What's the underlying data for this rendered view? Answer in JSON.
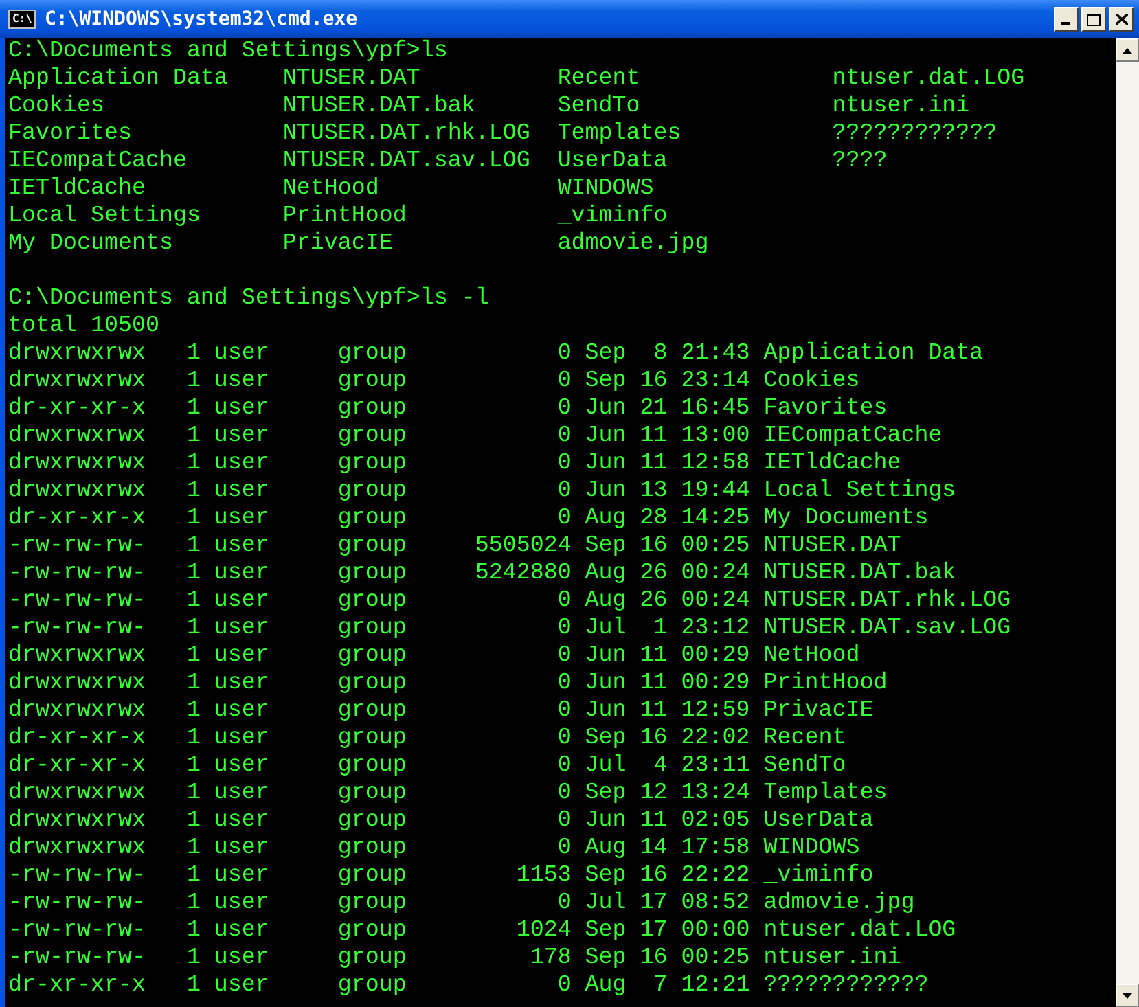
{
  "window": {
    "icon_label": "C:\\",
    "title": "C:\\WINDOWS\\system32\\cmd.exe"
  },
  "console": {
    "blocks": [
      [
        "C:\\Documents and Settings\\ypf>ls",
        "Application Data    NTUSER.DAT          Recent              ntuser.dat.LOG",
        "Cookies             NTUSER.DAT.bak      SendTo              ntuser.ini",
        "Favorites           NTUSER.DAT.rhk.LOG  Templates           ????????????",
        "IECompatCache       NTUSER.DAT.sav.LOG  UserData            ????",
        "IETldCache          NetHood             WINDOWS",
        "Local Settings      PrintHood           _viminfo",
        "My Documents        PrivacIE            admovie.jpg"
      ],
      [
        "C:\\Documents and Settings\\ypf>ls -l",
        "total 10500",
        "drwxrwxrwx   1 user     group           0 Sep  8 21:43 Application Data",
        "drwxrwxrwx   1 user     group           0 Sep 16 23:14 Cookies",
        "dr-xr-xr-x   1 user     group           0 Jun 21 16:45 Favorites",
        "drwxrwxrwx   1 user     group           0 Jun 11 13:00 IECompatCache",
        "drwxrwxrwx   1 user     group           0 Jun 11 12:58 IETldCache",
        "drwxrwxrwx   1 user     group           0 Jun 13 19:44 Local Settings",
        "dr-xr-xr-x   1 user     group           0 Aug 28 14:25 My Documents",
        "-rw-rw-rw-   1 user     group     5505024 Sep 16 00:25 NTUSER.DAT",
        "-rw-rw-rw-   1 user     group     5242880 Aug 26 00:24 NTUSER.DAT.bak",
        "-rw-rw-rw-   1 user     group           0 Aug 26 00:24 NTUSER.DAT.rhk.LOG",
        "-rw-rw-rw-   1 user     group           0 Jul  1 23:12 NTUSER.DAT.sav.LOG",
        "drwxrwxrwx   1 user     group           0 Jun 11 00:29 NetHood",
        "drwxrwxrwx   1 user     group           0 Jun 11 00:29 PrintHood",
        "drwxrwxrwx   1 user     group           0 Jun 11 12:59 PrivacIE",
        "dr-xr-xr-x   1 user     group           0 Sep 16 22:02 Recent",
        "dr-xr-xr-x   1 user     group           0 Jul  4 23:11 SendTo",
        "drwxrwxrwx   1 user     group           0 Sep 12 13:24 Templates",
        "drwxrwxrwx   1 user     group           0 Jun 11 02:05 UserData",
        "drwxrwxrwx   1 user     group           0 Aug 14 17:58 WINDOWS",
        "-rw-rw-rw-   1 user     group        1153 Sep 16 22:22 _viminfo",
        "-rw-rw-rw-   1 user     group           0 Jul 17 08:52 admovie.jpg",
        "-rw-rw-rw-   1 user     group        1024 Sep 17 00:00 ntuser.dat.LOG",
        "-rw-rw-rw-   1 user     group         178 Sep 16 00:25 ntuser.ini",
        "dr-xr-xr-x   1 user     group           0 Aug  7 12:21 ????????????"
      ]
    ]
  }
}
